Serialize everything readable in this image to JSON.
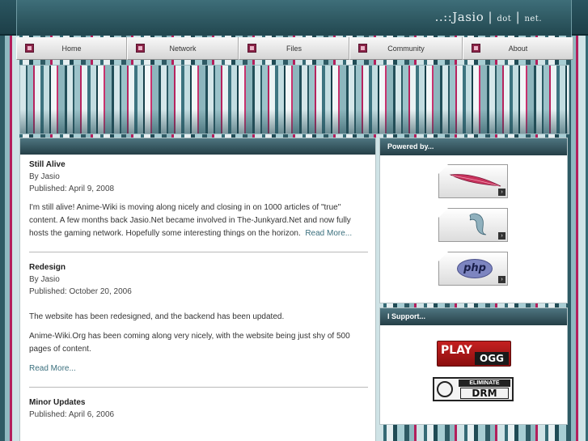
{
  "site": {
    "logo_prefix": "..::Jasio",
    "logo_dot": "dot",
    "logo_net": "net."
  },
  "nav": {
    "items": [
      {
        "label": "Home",
        "icon": "page-icon"
      },
      {
        "label": "Network",
        "icon": "page-icon"
      },
      {
        "label": "Files",
        "icon": "page-icon"
      },
      {
        "label": "Community",
        "icon": "page-icon"
      },
      {
        "label": "About",
        "icon": "page-icon"
      }
    ]
  },
  "posts": [
    {
      "title": "Still Alive",
      "author": "By Jasio",
      "published": "Published: April 9, 2008",
      "paragraphs": [
        "I'm still alive! Anime-Wiki is moving along nicely and closing in on 1000 articles of \"true\" content. A few months back Jasio.Net became involved in The-Junkyard.Net and now fully hosts the gaming network. Hopefully some interesting things on the horizon."
      ],
      "read_more": "Read More..."
    },
    {
      "title": "Redesign",
      "author": "By Jasio",
      "published": "Published: October 20, 2006",
      "paragraphs": [
        "The website has been redesigned, and the backend has been updated.",
        "Anime-Wiki.Org has been coming along very nicely, with the website being just shy of 500 pages of content."
      ],
      "read_more": "Read More..."
    },
    {
      "title": "Minor Updates",
      "author": "",
      "published": "Published: April 6, 2006",
      "paragraphs": [],
      "read_more": ""
    }
  ],
  "sidebar": {
    "powered_title": "Powered by...",
    "powered_badges": [
      "apache-feather-badge",
      "mysql-dolphin-badge",
      "php-badge"
    ],
    "php_text": "php",
    "support_title": "I Support...",
    "play_ogg": {
      "play": "PLAY",
      "ogg": "OGG"
    },
    "drm": {
      "eliminate": "ELIMINATE",
      "drm": "DRM"
    }
  },
  "colors": {
    "accent_teal": "#2b5963",
    "accent_magenta": "#b7245f",
    "link": "#3a6f7d"
  }
}
